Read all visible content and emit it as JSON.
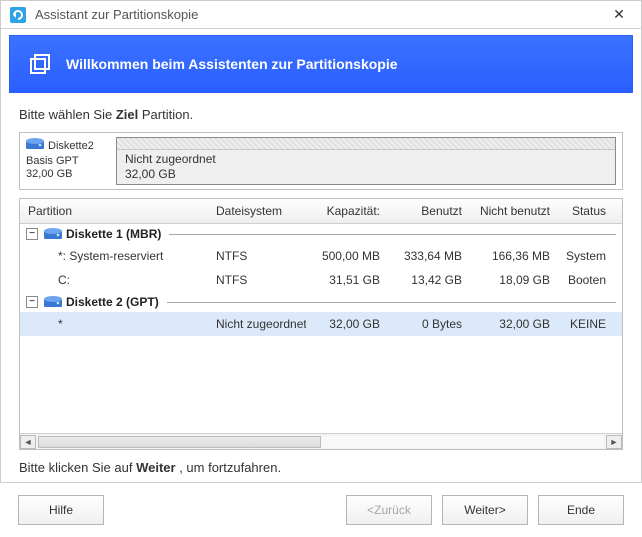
{
  "window": {
    "title": "Assistant zur Partitionskopie",
    "close_glyph": "✕"
  },
  "banner": {
    "title": "Willkommen beim Assistenten zur Partitionskopie"
  },
  "instructions": {
    "choose_pre": "Bitte wählen Sie ",
    "choose_bold": "Ziel",
    "choose_post": " Partition.",
    "continue_pre": "Bitte klicken Sie auf ",
    "continue_bold": "Weiter",
    "continue_post": " , um fortzufahren."
  },
  "disk_overview": {
    "name": "Diskette2",
    "scheme": "Basis GPT",
    "size": "32,00 GB",
    "bar_label1": "Nicht zugeordnet",
    "bar_label2": "32,00 GB"
  },
  "table": {
    "headers": {
      "partition": "Partition",
      "filesystem": "Dateisystem",
      "capacity": "Kapazität:",
      "used": "Benutzt",
      "unused": "Nicht benutzt",
      "status": "Status"
    },
    "groups": [
      {
        "label": "Diskette 1 (MBR)",
        "rows": [
          {
            "partition": "*: System-reserviert",
            "fs": "NTFS",
            "cap": "500,00 MB",
            "used": "333,64 MB",
            "free": "166,36 MB",
            "status": "System"
          },
          {
            "partition": "C:",
            "fs": "NTFS",
            "cap": "31,51 GB",
            "used": "13,42 GB",
            "free": "18,09 GB",
            "status": "Booten"
          }
        ]
      },
      {
        "label": "Diskette 2 (GPT)",
        "rows": [
          {
            "partition": "*",
            "fs": "Nicht zugeordnet",
            "cap": "32,00 GB",
            "used": "0 Bytes",
            "free": "32,00 GB",
            "status": "KEINE",
            "selected": true
          }
        ]
      }
    ]
  },
  "footer": {
    "help": "Hilfe",
    "back": "<Zurück",
    "next": "Weiter>",
    "end": "Ende"
  },
  "glyphs": {
    "collapse": "−",
    "scroll_left": "◄",
    "scroll_right": "►"
  }
}
